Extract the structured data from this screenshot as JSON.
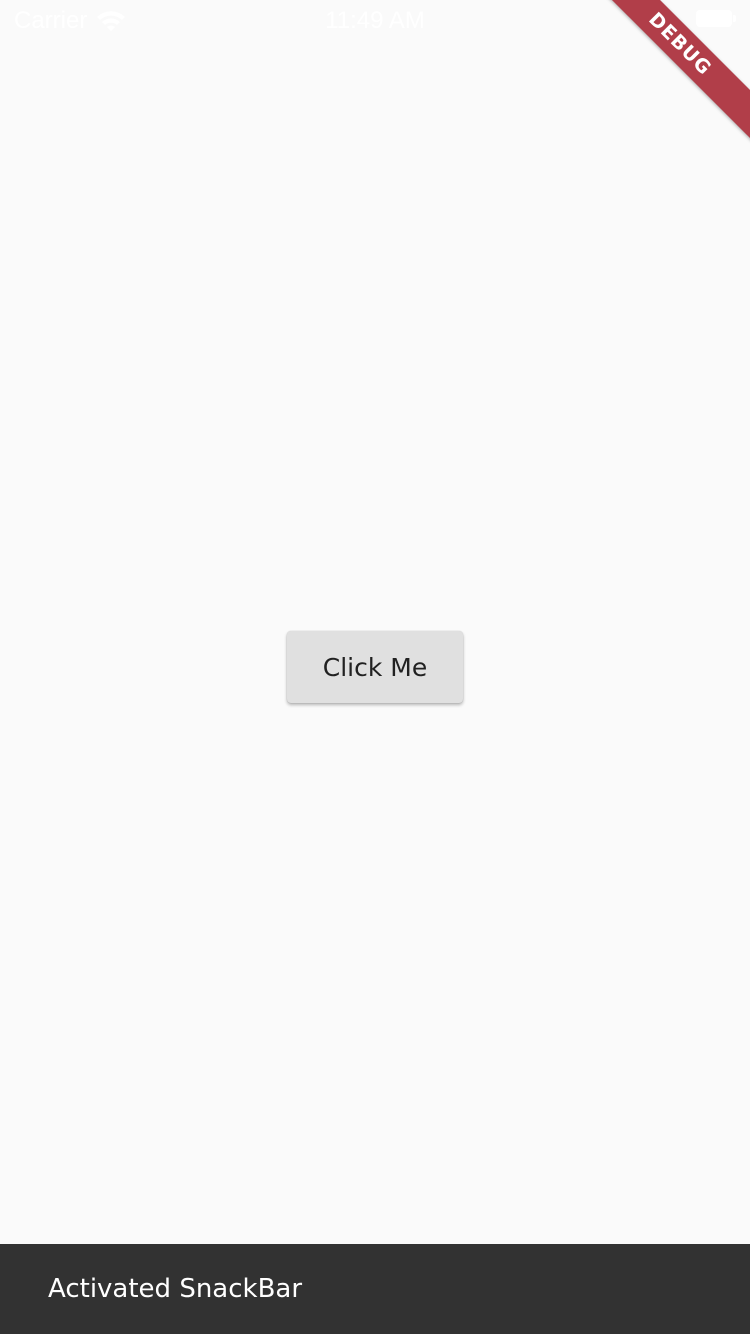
{
  "status_bar": {
    "carrier": "Carrier",
    "time": "11:49 AM",
    "icons": [
      "wifi-icon",
      "battery-icon"
    ]
  },
  "debug_banner": {
    "label": "DEBUG",
    "color": "#b13e49"
  },
  "main": {
    "button_label": "Click Me"
  },
  "snackbar": {
    "message": "Activated SnackBar",
    "background": "#323232"
  },
  "colors": {
    "background": "#fafafa",
    "button": "#e0e0e0"
  }
}
